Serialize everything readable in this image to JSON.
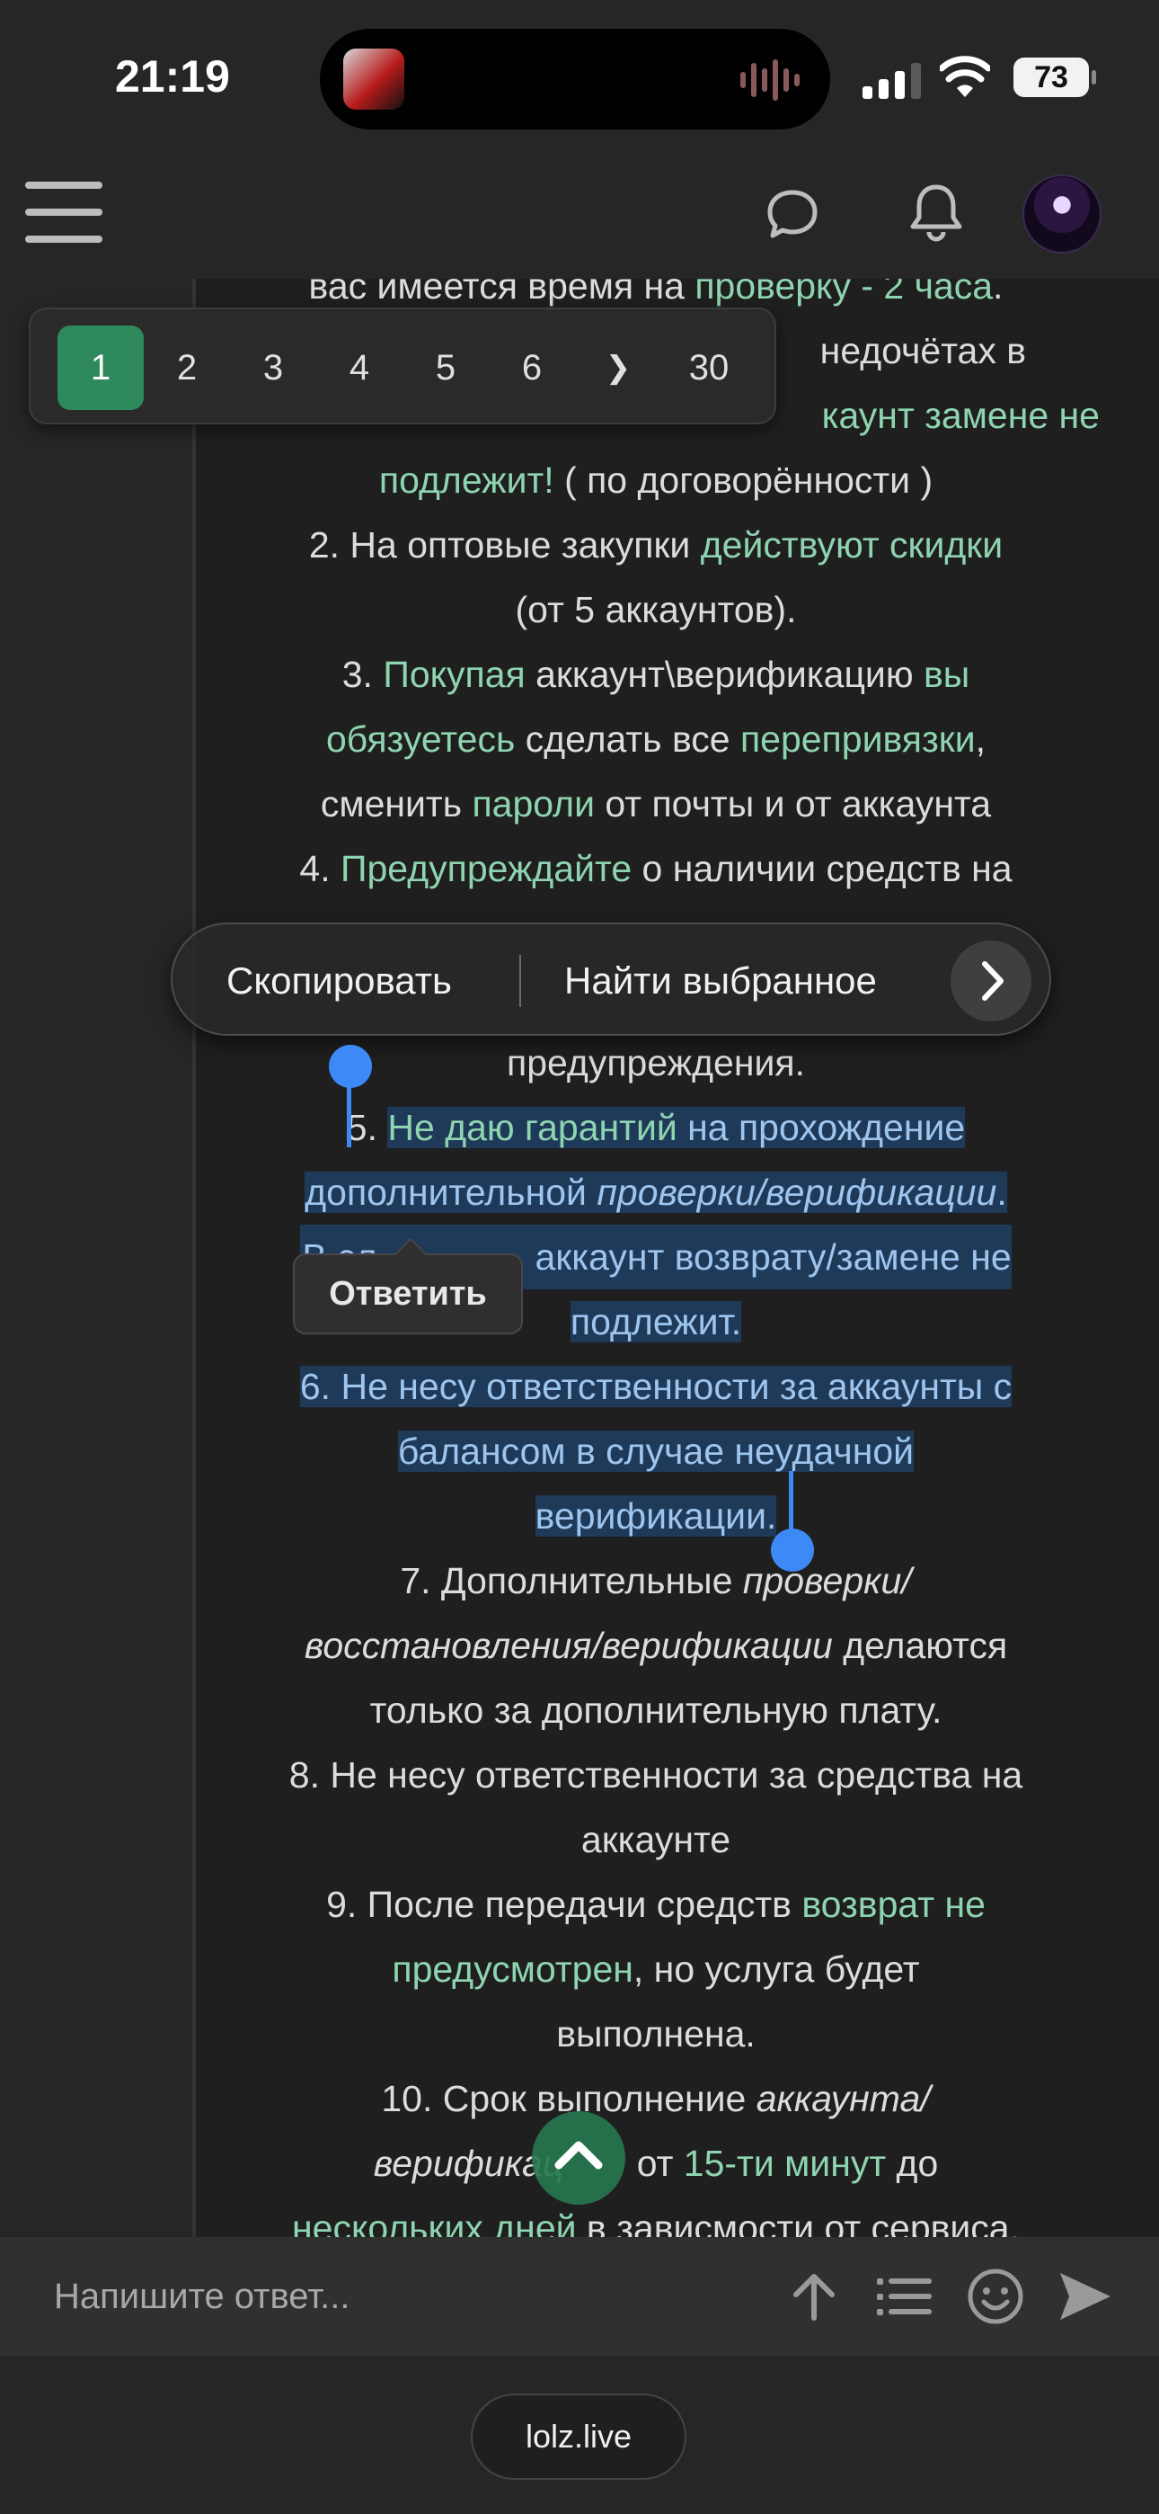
{
  "status_bar": {
    "time": "21:19",
    "battery": "73"
  },
  "page_nav": {
    "pages": [
      "1",
      "2",
      "3",
      "4",
      "5",
      "6"
    ],
    "next": "❯",
    "last": "30"
  },
  "context_menu": {
    "copy": "Скопировать",
    "find": "Найти выбранное",
    "more": "›"
  },
  "reply_tooltip": "Ответить",
  "reply_bar": {
    "placeholder": "Напишите ответ..."
  },
  "url": "lolz.live",
  "post": {
    "l1": {
      "a": "вас имеется время на ",
      "b": "проверку - 2 часа",
      "c": "."
    },
    "l2": {
      "a": "недочётах в"
    },
    "l3": {
      "a": "каунт замене не"
    },
    "l4": {
      "a": "подлежит!",
      "b": " ( по договорённости )"
    },
    "l5": {
      "a": "2. На оптовые закупки ",
      "b": "действуют скидки"
    },
    "l6": {
      "a": "(от 5 аккаунтов)."
    },
    "l7": {
      "a": "3. ",
      "b": "Покупая",
      "c": " аккаунт\\верификацию ",
      "d": "вы"
    },
    "l8": {
      "a": "обязуетесь",
      "b": " сделать все ",
      "c": "перепривязки",
      "d": ","
    },
    "l9": {
      "a": "сменить ",
      "b": "пароли",
      "c": " от почты и от аккаунта"
    },
    "l10": {
      "a": "4. ",
      "b": "Предупреждайте",
      "c": " о наличии средств на"
    },
    "l11": {
      "a": "предупреждения."
    },
    "l12": {
      "a": "5. ",
      "b": "Не даю гарантий",
      "c": " на прохождение"
    },
    "l13": {
      "a": "дополнительной ",
      "b": "проверки/верификации",
      "c": "."
    },
    "l14": {
      "a": "В сл",
      "b": "аккаунт возврату/замене не"
    },
    "l15": {
      "a": "подлежит."
    },
    "l16": {
      "a": "6. Не несу ответственности за аккаунты с"
    },
    "l17": {
      "a": "балансом в случае неудачной"
    },
    "l18": {
      "a": "верификации."
    },
    "l19": {
      "a": "7. Дополнительные ",
      "b": "проверки/"
    },
    "l20": {
      "a": "восстановления/верификации",
      "b": " делаются"
    },
    "l21": {
      "a": "только за дополнительную плату."
    },
    "l22": {
      "a": "8. Не несу ответственности за средства на"
    },
    "l23": {
      "a": "аккаунте"
    },
    "l24": {
      "a": "9. После передачи средств ",
      "b": "возврат не"
    },
    "l25": {
      "a": "предусмотрен",
      "b": ", но услуга будет"
    },
    "l26": {
      "a": "выполнена."
    },
    "l27": {
      "a": "10. Срок выполнение ",
      "b": "аккаунта/"
    },
    "l28": {
      "a": "верификац",
      "b": " от ",
      "c": "15-ти минут",
      "d": " до"
    },
    "l29": {
      "a": "нескольких дней",
      "b": " в зависмости от сервиса."
    }
  },
  "colors": {
    "accent_green": "#2e8a5c",
    "link_text": "#8fd4b0",
    "selection": "#1f3a59",
    "handle": "#3d8af7"
  },
  "icons": [
    "hamburger-icon",
    "chat-bubble-icon",
    "bell-icon",
    "avatar",
    "chevron-right-icon",
    "chevron-up-icon",
    "arrow-up-icon",
    "list-icon",
    "smile-icon",
    "send-icon"
  ]
}
